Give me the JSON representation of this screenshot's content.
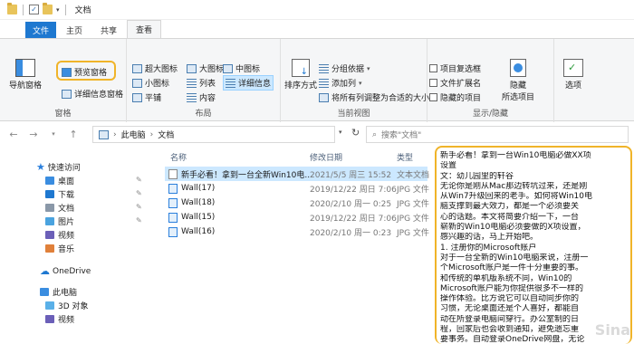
{
  "window": {
    "title": "文档"
  },
  "tabs": [
    "文件",
    "主页",
    "共享",
    "查看"
  ],
  "ribbon": {
    "panes": {
      "nav_pane": "导航窗格",
      "preview_pane": "预览窗格",
      "details_pane": "详细信息窗格",
      "label": "窗格"
    },
    "layout": {
      "items": [
        "超大图标",
        "大图标",
        "中图标",
        "小图标",
        "列表",
        "详细信息",
        "平铺",
        "内容"
      ],
      "label": "布局"
    },
    "current_view": {
      "sort": "排序方式",
      "group_by": "分组依据",
      "add_column": "添加列",
      "fit_columns": "将所有列调整为合适的大小",
      "label": "当前视图"
    },
    "show_hide": {
      "item_checkbox": "项目复选框",
      "file_ext": "文件扩展名",
      "hidden_items": "隐藏的项目",
      "hide_selected_1": "隐藏",
      "hide_selected_2": "所选项目",
      "options": "选项",
      "label": "显示/隐藏"
    }
  },
  "address": {
    "crumbs": [
      "此电脑",
      "文档"
    ],
    "search_placeholder": "搜索\"文档\""
  },
  "sidebar": {
    "items": [
      {
        "label": "快速访问"
      },
      {
        "label": "桌面"
      },
      {
        "label": "下载"
      },
      {
        "label": "文档"
      },
      {
        "label": "图片"
      },
      {
        "label": "视频"
      },
      {
        "label": "音乐"
      },
      {
        "label": "OneDrive"
      },
      {
        "label": "此电脑"
      },
      {
        "label": "3D 对象"
      },
      {
        "label": "视频"
      }
    ]
  },
  "filelist": {
    "headers": {
      "name": "名称",
      "date": "修改日期",
      "type": "类型"
    },
    "rows": [
      {
        "name": "新手必看！拿到一台全新Win10电...",
        "date": "2021/5/5 周三 15:52",
        "type": "文本文档"
      },
      {
        "name": "Wall(17)",
        "date": "2019/12/22 周日 7:06",
        "type": "JPG 文件"
      },
      {
        "name": "Wall(18)",
        "date": "2020/2/10 周一 0:25",
        "type": "JPG 文件"
      },
      {
        "name": "Wall(15)",
        "date": "2019/12/22 周日 7:06",
        "type": "JPG 文件"
      },
      {
        "name": "Wall(16)",
        "date": "2020/2/10 周一 0:23",
        "type": "JPG 文件"
      }
    ]
  },
  "preview": {
    "lines": [
      "新手必看！拿到一台Win10电脑必做XX项",
      "设置",
      "文：幼儿园里的轩谷",
      "无论你是刚从Mac那边转坑过来，还是刚",
      "从Win7升级回来的老手。如何将Win10电",
      "脑支撑到最大效力，都是一个必须要关",
      "心的话题。本文将简要介绍一下，一台",
      "崭新的Win10电脑必须要做的X项设置，",
      "感兴趣的话，马上开始吧。",
      "1. 注册你的Microsoft账户",
      "对于一台全新的Win10电脑来说，注册一",
      "个Microsoft账户是一件十分重要的事。",
      "和传统的单机版系统不同，Win10的",
      "Microsoft账户能为你提供很多不一样的",
      "操作体验。比方说它可以自动同步你的",
      "习惯，无论桌面还是个人喜好，都能自",
      "动在所登录电脑间穿行。办公室制的日",
      "程，回家后也会收到通知，避免遗忘重",
      "要事务。自动登录OneDrive网盘，无论"
    ]
  },
  "watermark": "Sina"
}
